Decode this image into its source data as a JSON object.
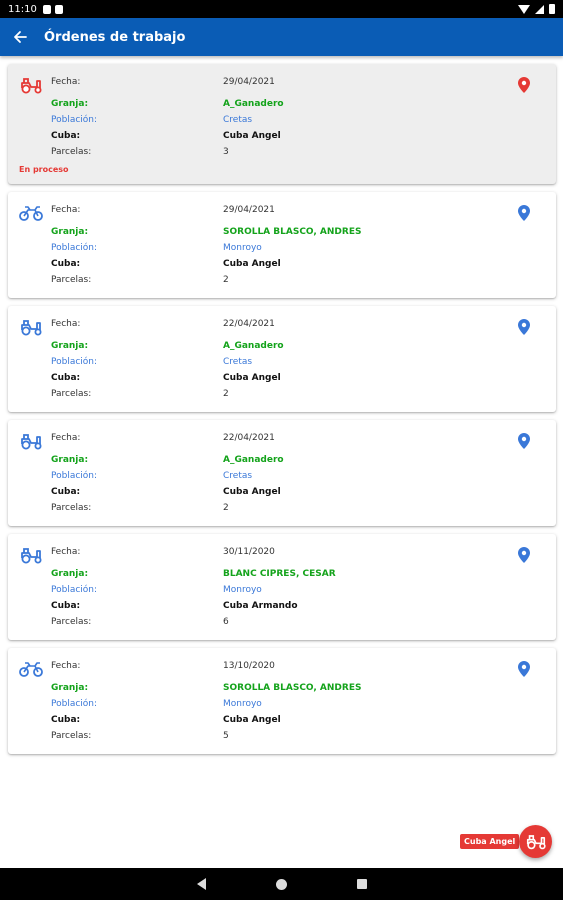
{
  "status_bar": {
    "time": "11:10"
  },
  "app_bar": {
    "back_icon": "arrow-left-icon",
    "title": "Órdenes de trabajo"
  },
  "labels": {
    "fecha": "Fecha:",
    "granja": "Granja:",
    "poblacion": "Población:",
    "cuba": "Cuba:",
    "parcelas": "Parcelas:"
  },
  "colors": {
    "primary": "#0a5cb5",
    "accent_red": "#e53935",
    "green": "#14a31b",
    "blue": "#3a78d8"
  },
  "orders": [
    {
      "fecha": "29/04/2021",
      "granja": "A_Ganadero",
      "poblacion": "Cretas",
      "cuba": "Cuba Angel",
      "parcelas": "3",
      "status": "En proceso",
      "icon": "tractor-icon",
      "active": true
    },
    {
      "fecha": "29/04/2021",
      "granja": "SOROLLA BLASCO, ANDRES",
      "poblacion": "Monroyo",
      "cuba": "Cuba Angel",
      "parcelas": "2",
      "icon": "motorbike-icon"
    },
    {
      "fecha": "22/04/2021",
      "granja": "A_Ganadero",
      "poblacion": "Cretas",
      "cuba": "Cuba Angel",
      "parcelas": "2",
      "icon": "tractor-icon"
    },
    {
      "fecha": "22/04/2021",
      "granja": "A_Ganadero",
      "poblacion": "Cretas",
      "cuba": "Cuba Angel",
      "parcelas": "2",
      "icon": "tractor-icon"
    },
    {
      "fecha": "30/11/2020",
      "granja": "BLANC CIPRES, CESAR",
      "poblacion": "Monroyo",
      "cuba": "Cuba Armando",
      "parcelas": "6",
      "icon": "tractor-icon"
    },
    {
      "fecha": "13/10/2020",
      "granja": "SOROLLA BLASCO, ANDRES",
      "poblacion": "Monroyo",
      "cuba": "Cuba Angel",
      "parcelas": "5",
      "icon": "motorbike-icon"
    }
  ],
  "fab": {
    "label": "Cuba Angel",
    "icon": "tractor-icon"
  }
}
